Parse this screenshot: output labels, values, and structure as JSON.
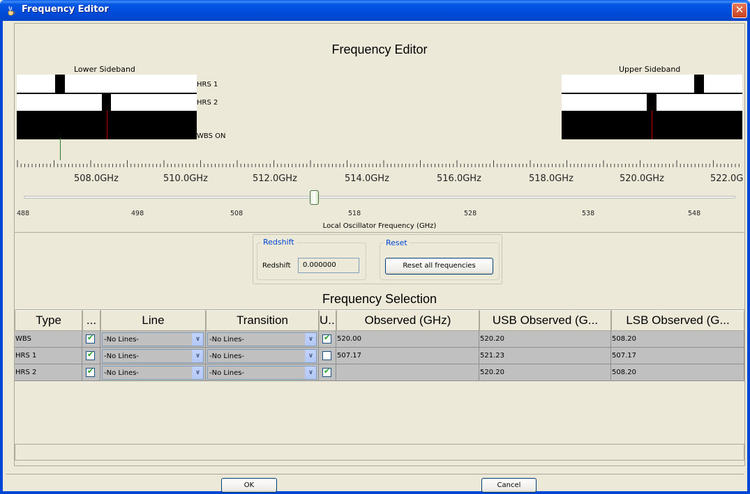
{
  "window": {
    "title": "Frequency Editor",
    "close_glyph": "✕",
    "icon": "java-cup-icon"
  },
  "editor": {
    "heading": "Frequency Editor",
    "lower_sideband_label": "Lower Sideband",
    "upper_sideband_label": "Upper Sideband",
    "bands": [
      "HRS 1",
      "HRS 2",
      "WBS ON"
    ],
    "ghz_ticks": [
      "508.0GHz",
      "510.0GHz",
      "512.0GHz",
      "514.0GHz",
      "516.0GHz",
      "518.0GHz",
      "520.0GHz",
      "522.0G"
    ],
    "lo_ticks": [
      "488",
      "498",
      "508",
      "518",
      "528",
      "538",
      "548"
    ],
    "lo_title": "Local Oscillator Frequency (GHz)",
    "lo_slider_value": 513.2
  },
  "redshift": {
    "group_title": "Redshift",
    "label": "Redshift",
    "value": "0.000000"
  },
  "reset": {
    "group_title": "Reset",
    "button_label": "Reset all frequencies"
  },
  "selection": {
    "heading": "Frequency Selection",
    "columns": [
      "Type",
      "...",
      "Line",
      "Transition",
      "U...",
      "Observed (GHz)",
      "USB Observed (G...",
      "LSB Observed (G..."
    ],
    "rows": [
      {
        "type": "WBS",
        "enabled": true,
        "line": "-No Lines-",
        "transition": "-No Lines-",
        "usb": true,
        "observed": "520.00",
        "usb_observed": "520.20",
        "lsb_observed": "508.20"
      },
      {
        "type": "HRS 1",
        "enabled": true,
        "line": "-No Lines-",
        "transition": "-No Lines-",
        "usb": false,
        "observed": "507.17",
        "usb_observed": "521.23",
        "lsb_observed": "507.17"
      },
      {
        "type": "HRS 2",
        "enabled": true,
        "line": "-No Lines-",
        "transition": "-No Lines-",
        "usb": true,
        "observed": "",
        "usb_observed": "520.20",
        "lsb_observed": "508.20"
      }
    ]
  },
  "buttons": {
    "ok": "OK",
    "cancel": "Cancel"
  }
}
